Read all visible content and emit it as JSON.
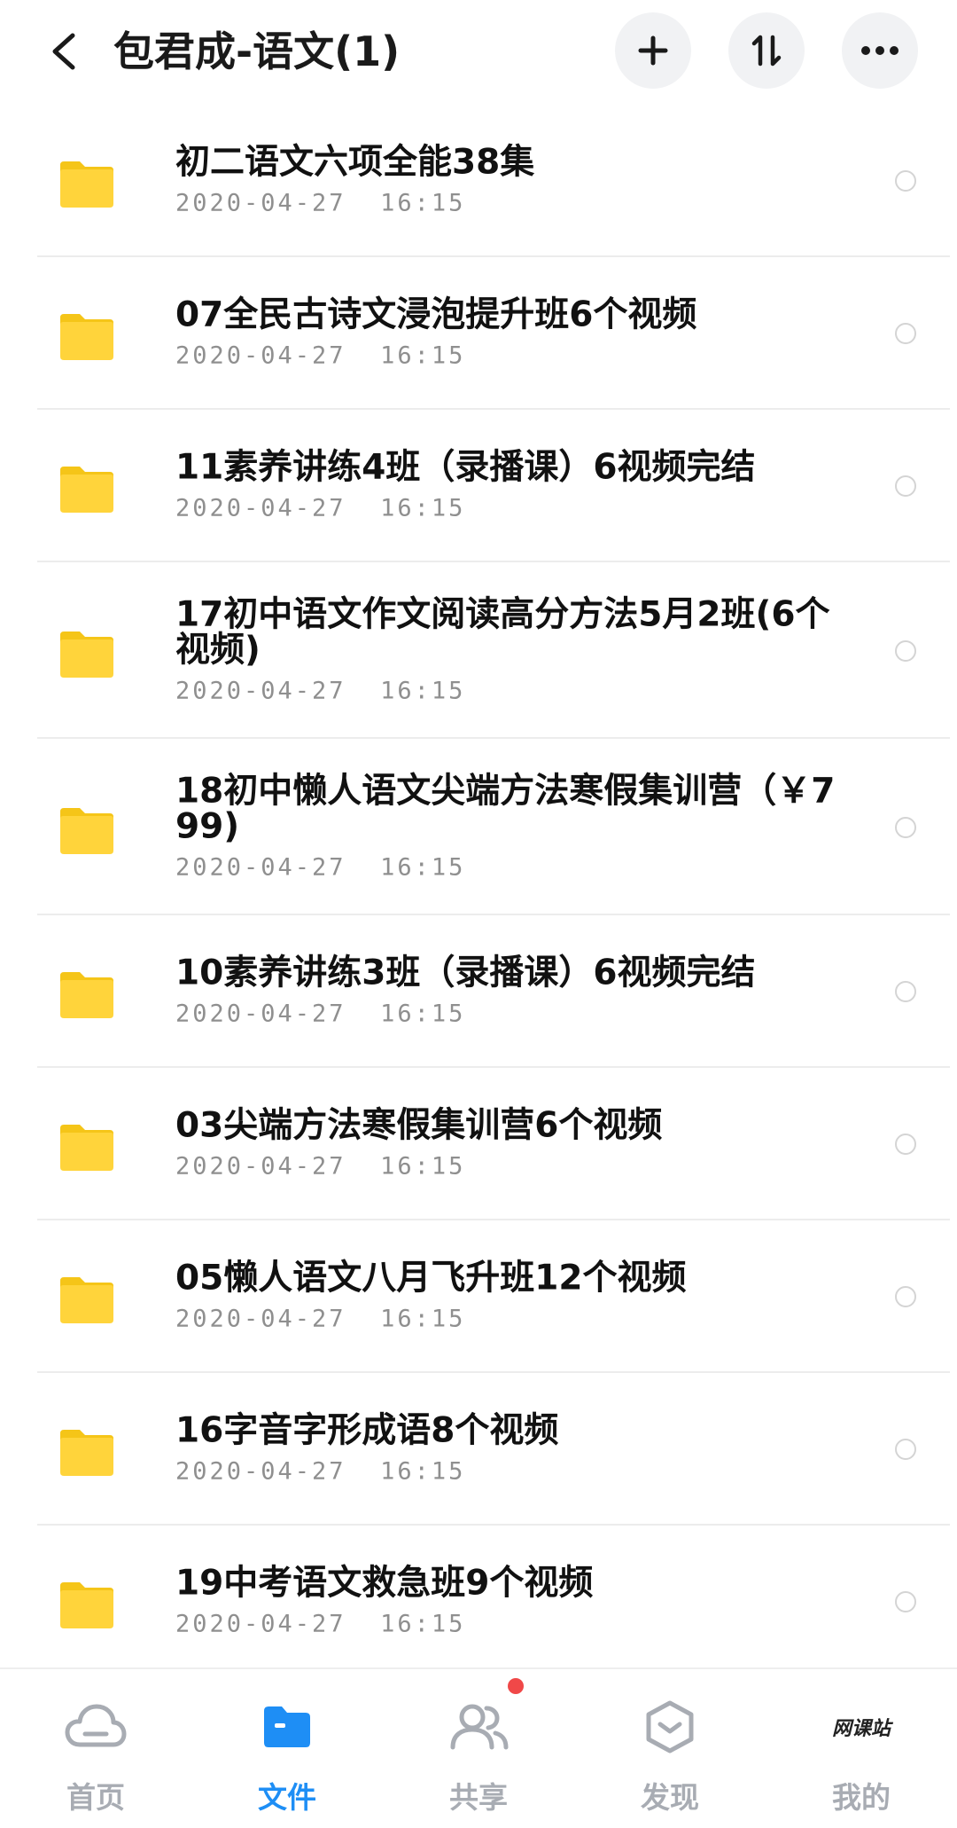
{
  "header": {
    "title": "包君成-语文(1)",
    "back_icon": "chevron-left-icon",
    "add_icon": "plus-icon",
    "sort_icon": "sort-arrows-icon",
    "more_icon": "more-dots-icon"
  },
  "colors": {
    "folder": "#FFD43B",
    "folder_tab": "#F5C518",
    "accent": "#1E8EF5",
    "inactive": "#A8ACB3",
    "badge": "#F04848"
  },
  "files": [
    {
      "name": "初二语文六项全能38集",
      "date": "2020-04-27  16:15"
    },
    {
      "name": "07全民古诗文浸泡提升班6个视频",
      "date": "2020-04-27  16:15"
    },
    {
      "name": "11素养讲练4班（录播课）6视频完结",
      "date": "2020-04-27  16:15"
    },
    {
      "name": "17初中语文作文阅读高分方法5月2班(6个视频)",
      "date": "2020-04-27  16:15"
    },
    {
      "name": "18初中懒人语文尖端方法寒假集训营（￥799)",
      "date": "2020-04-27  16:15"
    },
    {
      "name": "10素养讲练3班（录播课）6视频完结",
      "date": "2020-04-27  16:15"
    },
    {
      "name": "03尖端方法寒假集训营6个视频",
      "date": "2020-04-27  16:15"
    },
    {
      "name": "05懒人语文八月飞升班12个视频",
      "date": "2020-04-27  16:15"
    },
    {
      "name": "16字音字形成语8个视频",
      "date": "2020-04-27  16:15"
    },
    {
      "name": "19中考语文救急班9个视频",
      "date": "2020-04-27  16:15"
    }
  ],
  "nav": [
    {
      "label": "首页",
      "icon": "cloud-icon",
      "active": false
    },
    {
      "label": "文件",
      "icon": "folder-icon",
      "active": true
    },
    {
      "label": "共享",
      "icon": "people-icon",
      "active": false
    },
    {
      "label": "发现",
      "icon": "discover-icon",
      "active": false
    },
    {
      "label": "我的",
      "icon": "avatar-logo-icon",
      "active": false,
      "logo_text": "网课站"
    }
  ]
}
